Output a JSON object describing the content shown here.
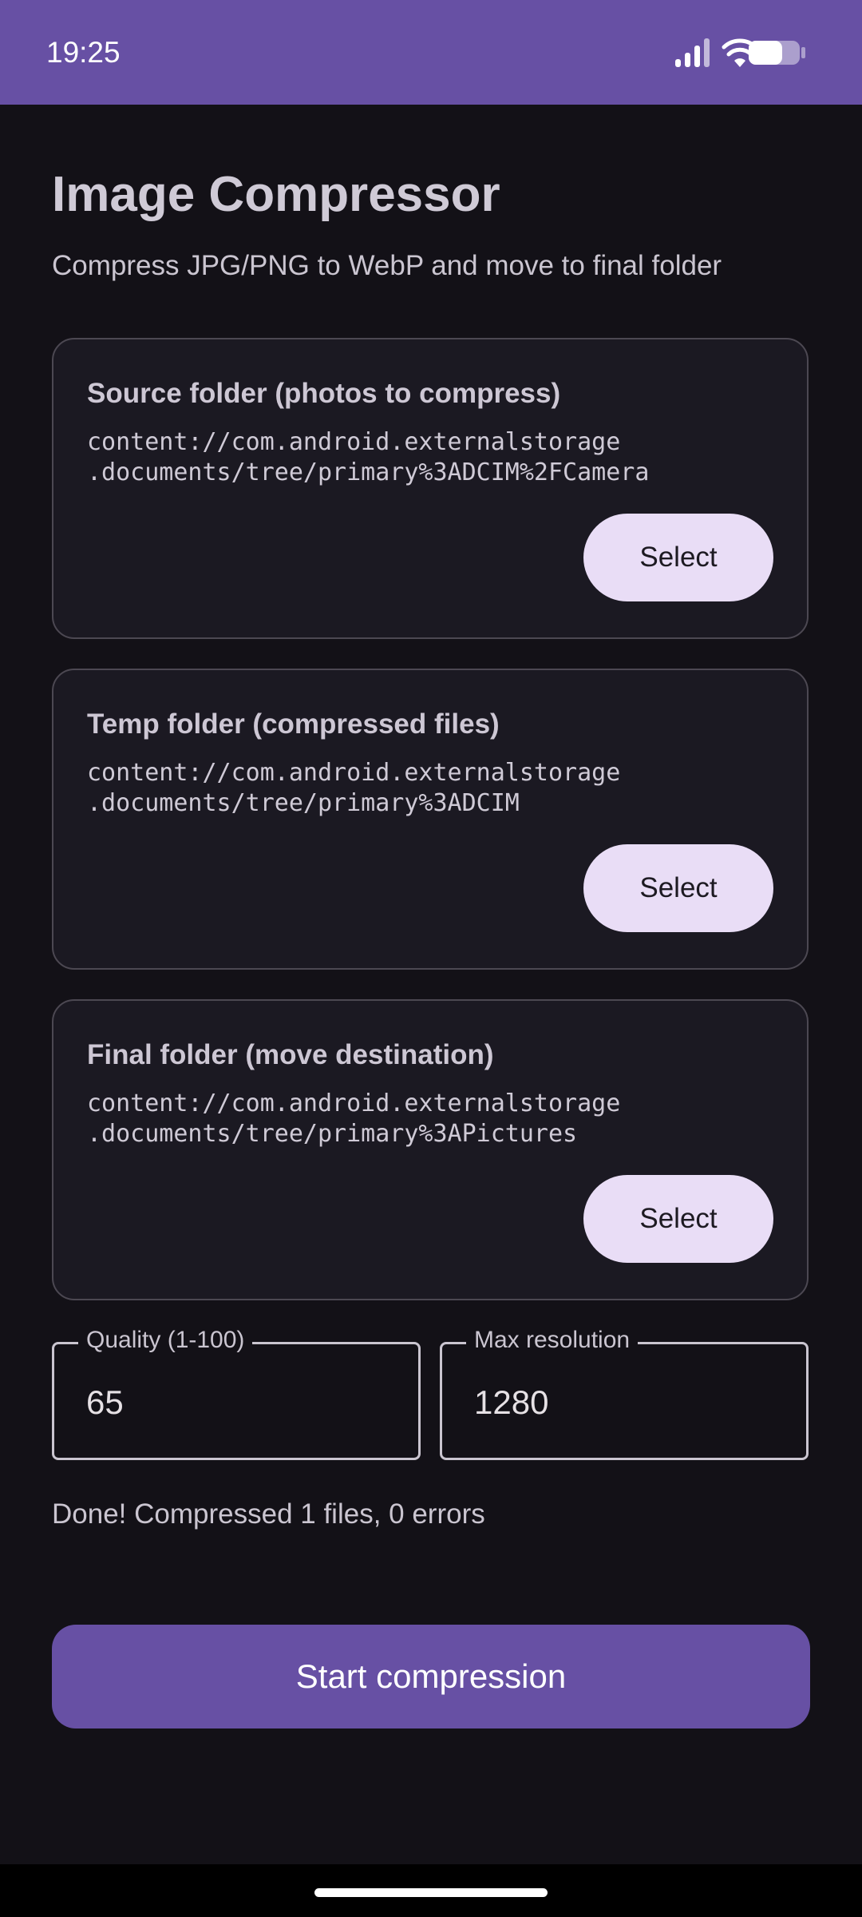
{
  "status_bar": {
    "time": "19:25",
    "icons": [
      "signal-icon",
      "wifi-icon",
      "battery-icon"
    ]
  },
  "header": {
    "title": "Image Compressor",
    "subtitle": "Compress JPG/PNG to WebP and move to final folder"
  },
  "folders": [
    {
      "title": "Source folder (photos to compress)",
      "path": "content://com.android.externalstorage\n.documents/tree/primary%3ADCIM%2FCamera",
      "button_label": "Select"
    },
    {
      "title": "Temp folder (compressed files)",
      "path": "content://com.android.externalstorage\n.documents/tree/primary%3ADCIM",
      "button_label": "Select"
    },
    {
      "title": "Final folder (move destination)",
      "path": "content://com.android.externalstorage\n.documents/tree/primary%3APictures",
      "button_label": "Select"
    }
  ],
  "settings": {
    "quality": {
      "label": "Quality (1-100)",
      "value": "65"
    },
    "max_resolution": {
      "label": "Max resolution",
      "value": "1280"
    }
  },
  "status_message": "Done! Compressed 1 files, 0 errors",
  "actions": {
    "start_label": "Start compression"
  },
  "colors": {
    "primary": "#6750a4",
    "background": "#131117",
    "card": "#1b1922",
    "tonal_button": "#e9ddf6"
  }
}
